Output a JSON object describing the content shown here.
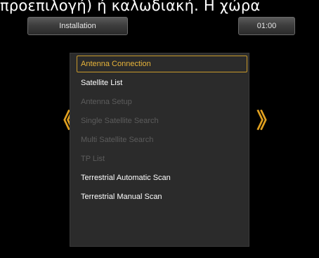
{
  "header_text": "προεπιλογή) ή καλωδιακή. Η χώρα",
  "title": "Installation",
  "clock": "01:00",
  "nav": {
    "left_arrow": "《",
    "right_arrow": "》"
  },
  "menu": {
    "items": [
      {
        "label": "Antenna Connection",
        "state": "selected"
      },
      {
        "label": "Satellite List",
        "state": "enabled"
      },
      {
        "label": "Antenna Setup",
        "state": "disabled"
      },
      {
        "label": "Single Satellite Search",
        "state": "disabled"
      },
      {
        "label": "Multi Satellite Search",
        "state": "disabled"
      },
      {
        "label": "TP List",
        "state": "disabled"
      },
      {
        "label": "Terrestrial Automatic Scan",
        "state": "enabled"
      },
      {
        "label": "Terrestrial Manual Scan",
        "state": "enabled"
      }
    ]
  },
  "colors": {
    "selected_text": "#e8b43a",
    "disabled_text": "#5c5c5c",
    "arrow": "#e0a020",
    "menu_background": "#2b2b2b"
  }
}
